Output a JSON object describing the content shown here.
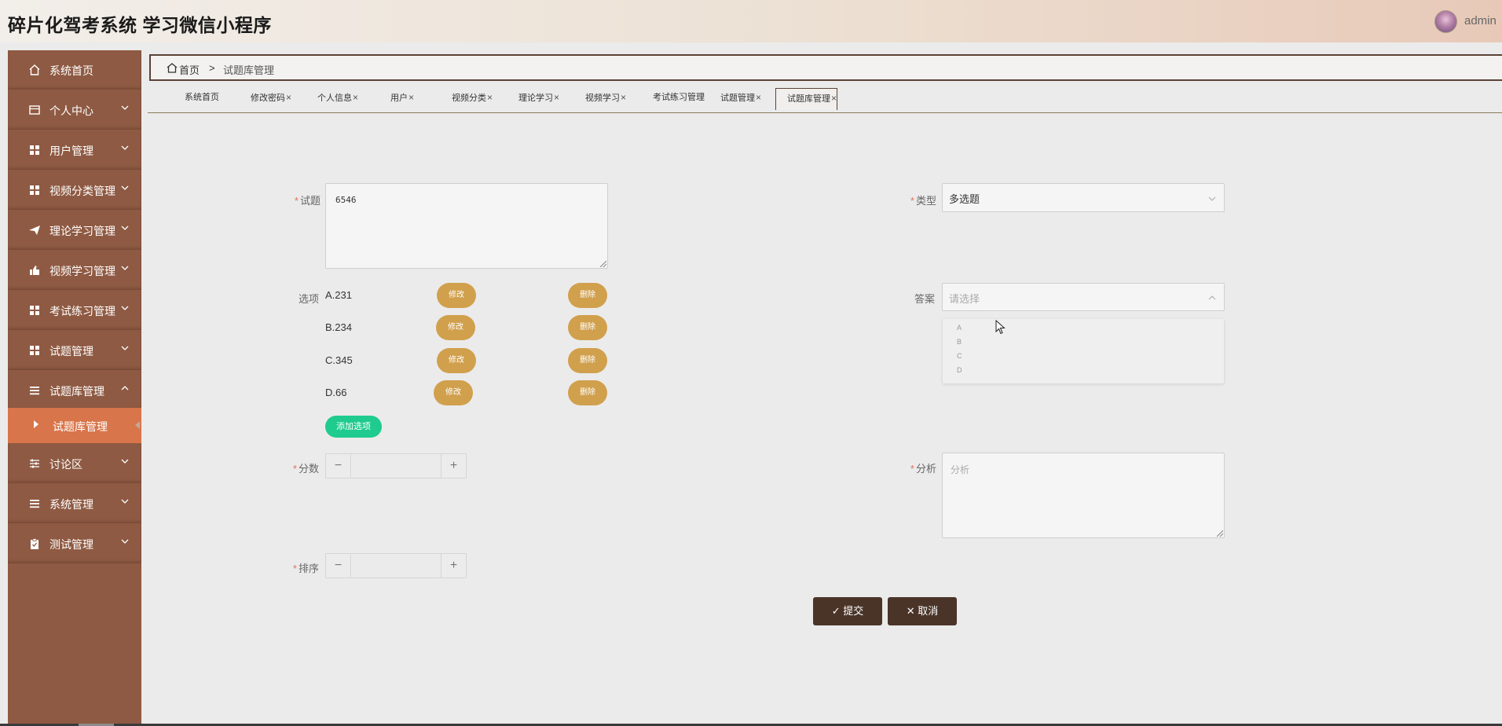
{
  "header": {
    "title": "碎片化驾考系统 学习微信小程序",
    "user": "admin"
  },
  "sidebar": {
    "items": [
      {
        "label": "系统首页",
        "icon": "home-icon",
        "expandable": false
      },
      {
        "label": "个人中心",
        "icon": "card-icon",
        "expandable": true
      },
      {
        "label": "用户管理",
        "icon": "grid-icon",
        "expandable": true
      },
      {
        "label": "视频分类管理",
        "icon": "grid-icon",
        "expandable": true
      },
      {
        "label": "理论学习管理",
        "icon": "paper-plane-icon",
        "expandable": true
      },
      {
        "label": "视频学习管理",
        "icon": "thumb-up-icon",
        "expandable": true
      },
      {
        "label": "考试练习管理",
        "icon": "grid-icon",
        "expandable": true
      },
      {
        "label": "试题管理",
        "icon": "grid-icon",
        "expandable": true
      },
      {
        "label": "试题库管理",
        "icon": "list-icon",
        "expandable": true,
        "expanded": true
      },
      {
        "label": "讨论区",
        "icon": "sliders-icon",
        "expandable": true
      },
      {
        "label": "系统管理",
        "icon": "list-icon",
        "expandable": true
      },
      {
        "label": "测试管理",
        "icon": "clipboard-icon",
        "expandable": true
      }
    ],
    "active_sub": "试题库管理"
  },
  "breadcrumb": {
    "home": "首页",
    "separator": ">",
    "current": "试题库管理"
  },
  "tabs": [
    {
      "label": "系统首页",
      "closable": false
    },
    {
      "label": "修改密码",
      "closable": true
    },
    {
      "label": "个人信息",
      "closable": true
    },
    {
      "label": "用户",
      "closable": true
    },
    {
      "label": "视频分类",
      "closable": true
    },
    {
      "label": "理论学习",
      "closable": true
    },
    {
      "label": "视频学习",
      "closable": true
    },
    {
      "label": "考试练习管理",
      "closable": false
    },
    {
      "label": "试题管理",
      "closable": true
    },
    {
      "label": "试题库管理",
      "closable": true,
      "active": true
    }
  ],
  "form": {
    "question_label": "试题",
    "question_value": "6546",
    "type_label": "类型",
    "type_value": "多选题",
    "options_label": "选项",
    "options": [
      "A.231",
      "B.234",
      "C.345",
      "D.66"
    ],
    "edit_label": "修改",
    "delete_label": "删除",
    "add_option_label": "添加选项",
    "answer_label": "答案",
    "answer_placeholder": "请选择",
    "answer_choices": [
      "A",
      "B",
      "C",
      "D"
    ],
    "score_label": "分数",
    "analysis_label": "分析",
    "analysis_placeholder": "分析",
    "order_label": "排序",
    "submit_label": "提交",
    "cancel_label": "取消"
  },
  "colors": {
    "sidebar_bg": "#8f5a43",
    "sidebar_active": "#d9754a",
    "pill_button": "#d1a04d",
    "add_button": "#1fcb8e",
    "dark_button": "#4a3428",
    "required_mark": "#e2705a"
  }
}
